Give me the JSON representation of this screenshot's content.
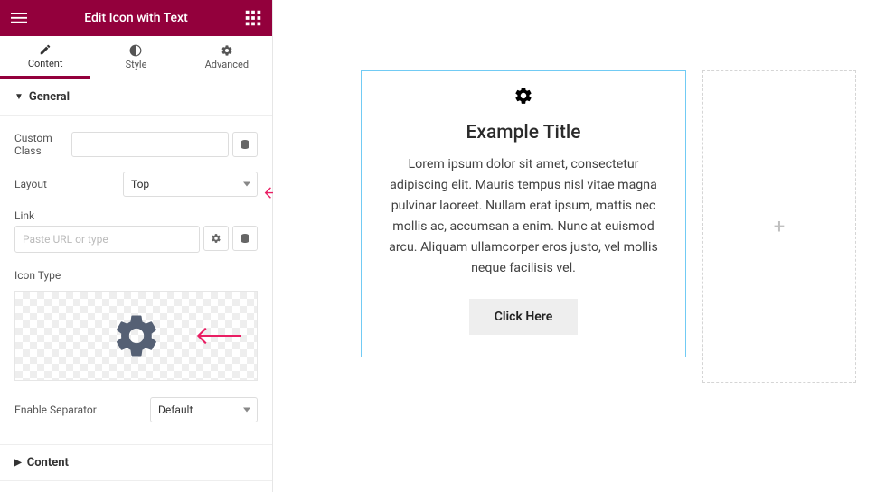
{
  "header": {
    "title": "Edit Icon with Text"
  },
  "tabs": [
    {
      "label": "Content"
    },
    {
      "label": "Style"
    },
    {
      "label": "Advanced"
    }
  ],
  "section_general": {
    "title": "General"
  },
  "fields": {
    "custom_class": {
      "label": "Custom Class",
      "value": ""
    },
    "layout": {
      "label": "Layout",
      "value": "Top"
    },
    "link": {
      "label": "Link",
      "placeholder": "Paste URL or type"
    },
    "icon_type": {
      "label": "Icon Type"
    },
    "enable_separator": {
      "label": "Enable Separator",
      "value": "Default"
    }
  },
  "section_content": {
    "title": "Content"
  },
  "preview": {
    "title": "Example Title",
    "body": "Lorem ipsum dolor sit amet, consectetur adipiscing elit. Mauris tempus nisl vitae magna pulvinar laoreet. Nullam erat ipsum, mattis nec mollis ac, accumsan a enim. Nunc at euismod arcu. Aliquam ullamcorper eros justo, vel mollis neque facilisis vel.",
    "button": "Click Here"
  }
}
